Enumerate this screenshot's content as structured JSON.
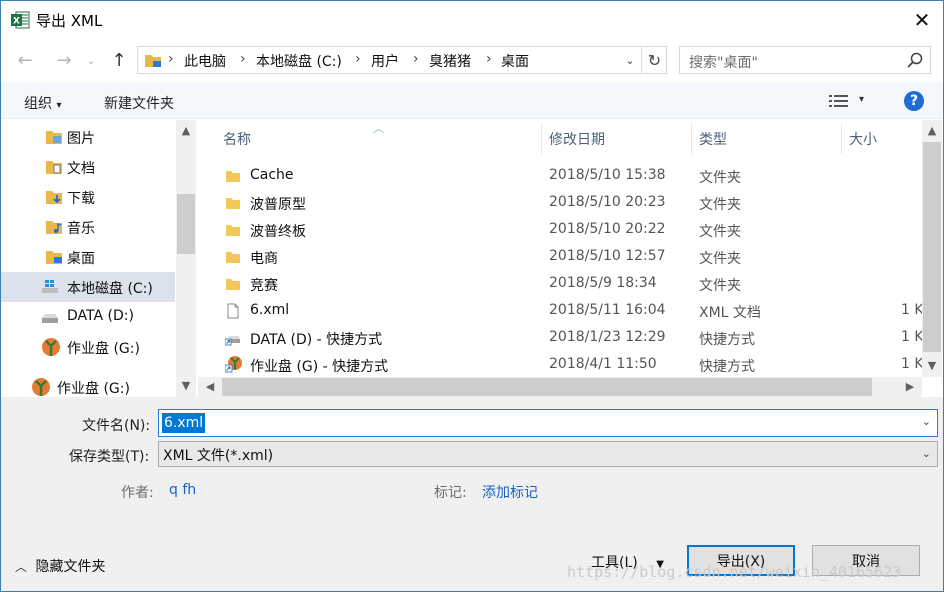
{
  "window": {
    "title": "导出 XML"
  },
  "nav": {
    "breadcrumb": [
      "此电脑",
      "本地磁盘 (C:)",
      "用户",
      "臭猪猪",
      "桌面"
    ],
    "search_placeholder": "搜索\"桌面\""
  },
  "toolbar": {
    "organize": "组织",
    "new_folder": "新建文件夹"
  },
  "sidebar": {
    "items": [
      {
        "label": "图片",
        "icon": "pictures-folder-icon"
      },
      {
        "label": "文档",
        "icon": "documents-folder-icon"
      },
      {
        "label": "下载",
        "icon": "downloads-folder-icon"
      },
      {
        "label": "音乐",
        "icon": "music-folder-icon"
      },
      {
        "label": "桌面",
        "icon": "desktop-folder-icon"
      },
      {
        "label": "本地磁盘 (C:)",
        "icon": "windows-drive-icon",
        "selected": true
      },
      {
        "label": "DATA (D:)",
        "icon": "drive-icon"
      },
      {
        "label": "作业盘 (G:)",
        "icon": "network-drive-icon"
      },
      {
        "label": "作业盘 (G:)",
        "icon": "network-drive-icon"
      }
    ]
  },
  "columns": {
    "name": "名称",
    "date": "修改日期",
    "type": "类型",
    "size": "大小"
  },
  "files": [
    {
      "name": "Cache",
      "date": "2018/5/10 15:38",
      "type": "文件夹",
      "size": "",
      "icon": "folder-icon"
    },
    {
      "name": "波普原型",
      "date": "2018/5/10 20:23",
      "type": "文件夹",
      "size": "",
      "icon": "folder-icon"
    },
    {
      "name": "波普终板",
      "date": "2018/5/10 20:22",
      "type": "文件夹",
      "size": "",
      "icon": "folder-icon"
    },
    {
      "name": "电商",
      "date": "2018/5/10 12:57",
      "type": "文件夹",
      "size": "",
      "icon": "folder-icon"
    },
    {
      "name": "竞赛",
      "date": "2018/5/9 18:34",
      "type": "文件夹",
      "size": "",
      "icon": "folder-icon"
    },
    {
      "name": "6.xml",
      "date": "2018/5/11 16:04",
      "type": "XML 文档",
      "size": "1 K",
      "icon": "xml-file-icon"
    },
    {
      "name": "DATA (D) - 快捷方式",
      "date": "2018/1/23 12:29",
      "type": "快捷方式",
      "size": "1 K",
      "icon": "shortcut-drive-icon"
    },
    {
      "name": "作业盘 (G) - 快捷方式",
      "date": "2018/4/1 11:50",
      "type": "快捷方式",
      "size": "1 K",
      "icon": "shortcut-network-icon"
    }
  ],
  "form": {
    "filename_label": "文件名(N):",
    "filename_value": "6.xml",
    "filetype_label": "保存类型(T):",
    "filetype_value": "XML 文件(*.xml)",
    "author_label": "作者:",
    "author_value": "q fh",
    "tags_label": "标记:",
    "tags_value": "添加标记"
  },
  "footer": {
    "hide_folders": "隐藏文件夹",
    "tools": "工具(L)",
    "export": "导出(X)",
    "cancel": "取消",
    "watermark": "https://blog.csdn.net/weixin_40165623"
  },
  "colors": {
    "accent": "#0078d7",
    "selected_nav": "#dbe2ec",
    "link": "#1a62c4"
  }
}
